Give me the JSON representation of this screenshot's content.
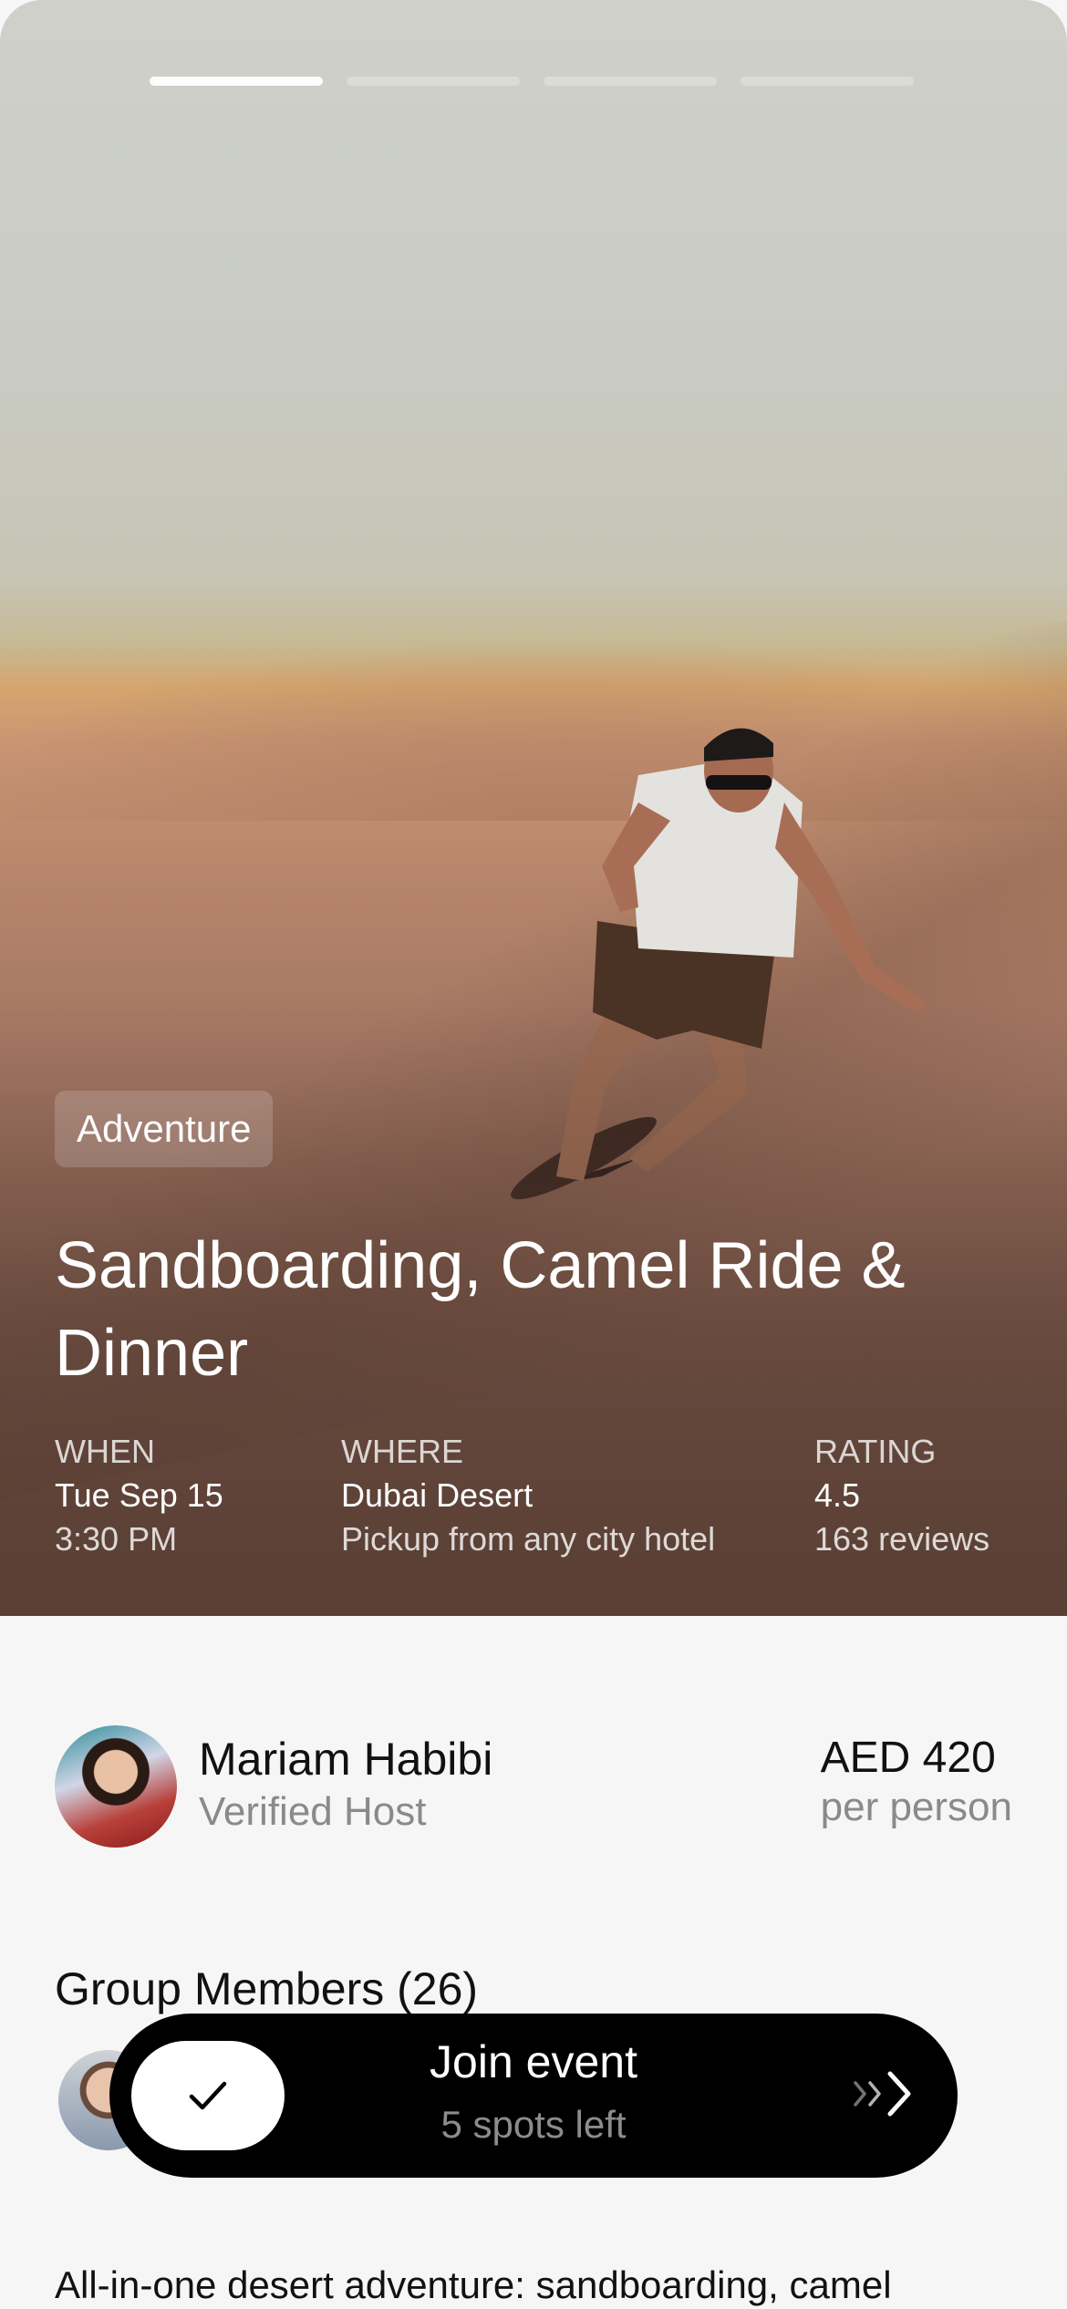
{
  "story": {
    "segments": 4,
    "active_index": 0
  },
  "event": {
    "category": "Adventure",
    "title": "Sandboarding, Camel Ride & Dinner",
    "when": {
      "label": "WHEN",
      "date": "Tue Sep 15",
      "time": "3:30 PM"
    },
    "where": {
      "label": "WHERE",
      "place": "Dubai Desert",
      "note": "Pickup from any city hotel"
    },
    "rating": {
      "label": "RATING",
      "value": "4.5",
      "reviews": "163 reviews"
    }
  },
  "host": {
    "name": "Mariam Habibi",
    "subtitle": "Verified Host"
  },
  "price": {
    "amount": "AED 420",
    "unit": "per person"
  },
  "group": {
    "title": "Group Members (26)"
  },
  "join": {
    "label": "Join event",
    "spots": "5 spots left",
    "knob_icon": "check-icon",
    "arrow_icon": "chevron-right-icon"
  },
  "description": "All-in-one desert adventure: sandboarding, camel",
  "colors": {
    "cta_background": "#000000",
    "page_background": "#f6f6f6"
  }
}
